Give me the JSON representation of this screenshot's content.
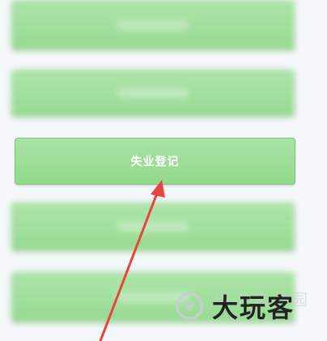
{
  "buttons": {
    "unemployment_registration": "失业登记"
  },
  "watermark": {
    "brand": "大玩客",
    "faint": "当下软件园"
  },
  "colors": {
    "button_fill": "#9bdc96",
    "button_border": "#7cc276",
    "arrow": "#e9443f",
    "background": "#f5f8fb"
  },
  "icons": {
    "arrow": "red-pointer-arrow",
    "logo": "ring-logo"
  }
}
